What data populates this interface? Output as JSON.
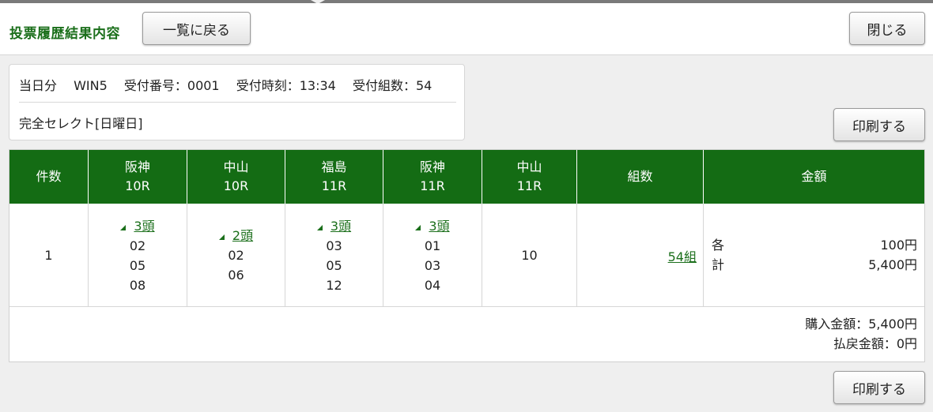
{
  "header": {
    "title": "投票履歴結果内容",
    "back_label": "一覧に戻る",
    "close_label": "閉じる"
  },
  "info": {
    "day": "当日分",
    "type": "WIN5",
    "receipt_no": "受付番号：0001",
    "receipt_time": "受付時刻：13:34",
    "receipt_count": "受付組数：54",
    "selection": "完全セレクト[日曜日]"
  },
  "print_label": "印刷する",
  "table": {
    "headers": {
      "count": "件数",
      "combos": "組数",
      "amount": "金額"
    },
    "races": [
      {
        "venue": "阪神",
        "race": "10R",
        "heads": "3頭",
        "horses": [
          "02",
          "05",
          "08"
        ]
      },
      {
        "venue": "中山",
        "race": "10R",
        "heads": "2頭",
        "horses": [
          "02",
          "06"
        ]
      },
      {
        "venue": "福島",
        "race": "11R",
        "heads": "3頭",
        "horses": [
          "03",
          "05",
          "12"
        ]
      },
      {
        "venue": "阪神",
        "race": "11R",
        "heads": "3頭",
        "horses": [
          "01",
          "03",
          "04"
        ]
      },
      {
        "venue": "中山",
        "race": "11R",
        "heads": "",
        "horses": [
          "10"
        ]
      }
    ],
    "row": {
      "count": "1",
      "combos": "54組",
      "each_label": "各",
      "total_label": "計",
      "each_amount": "100円",
      "total_amount": "5,400円"
    },
    "summary": {
      "purchase": "購入金額：5,400円",
      "refund": "払戻金額：0円"
    }
  }
}
